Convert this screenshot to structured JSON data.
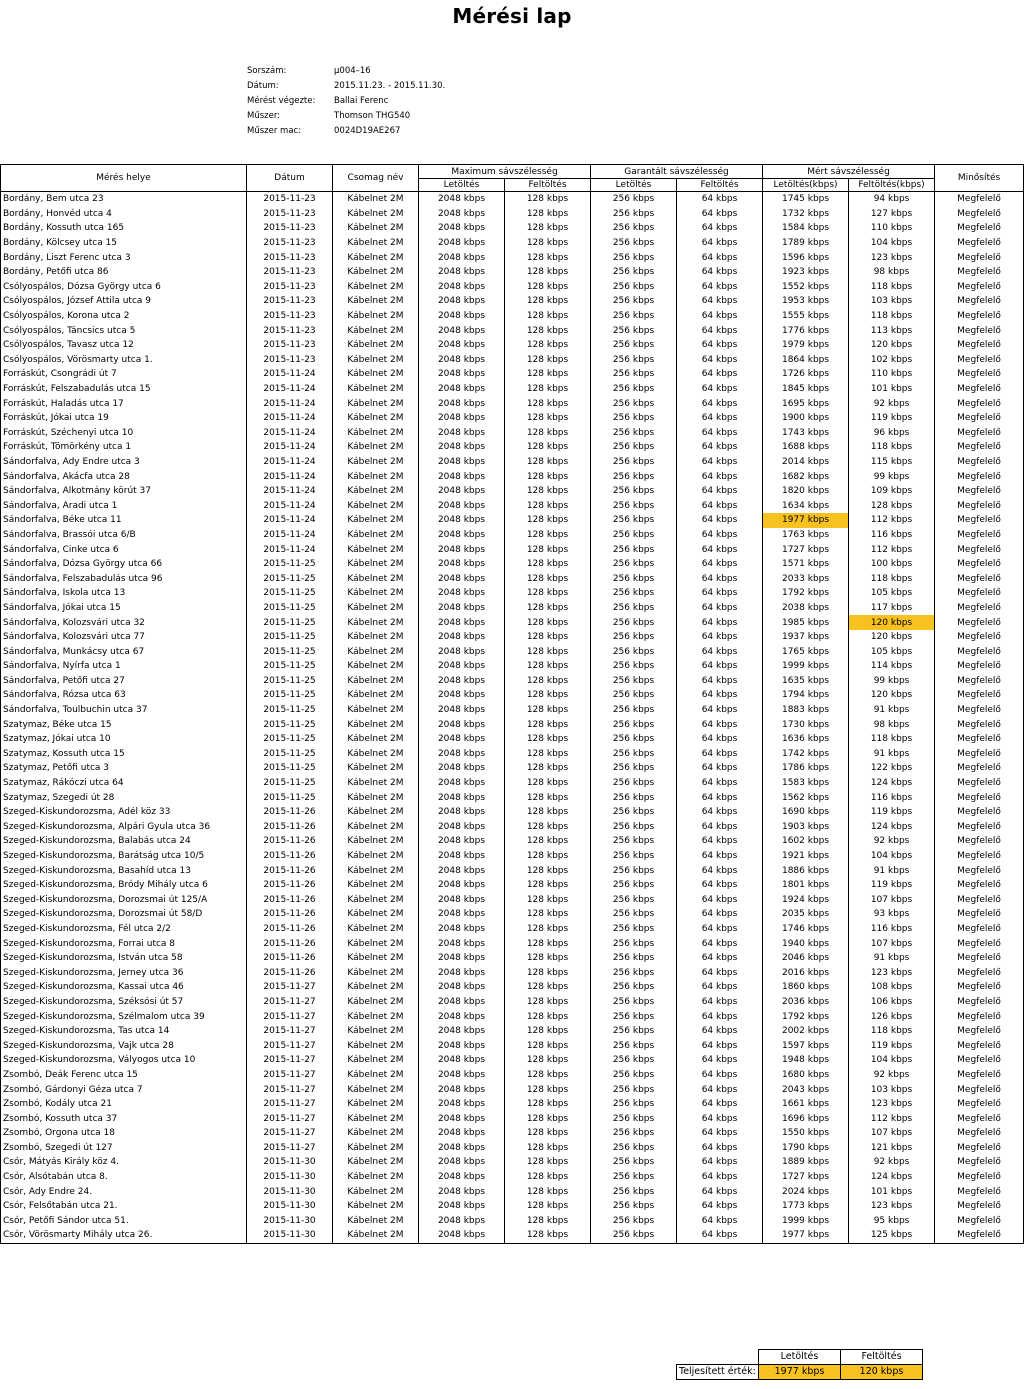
{
  "title": "Mérési lap",
  "meta": [
    {
      "label": "Sorszám:",
      "value": "µ004–16"
    },
    {
      "label": "Dátum:",
      "value": "2015.11.23. - 2015.11.30."
    },
    {
      "label": "Mérést végezte:",
      "value": "Ballai Ferenc"
    },
    {
      "label": "Műszer:",
      "value": "Thomson THG540"
    },
    {
      "label": "Műszer mac:",
      "value": "0024D19AE267"
    }
  ],
  "headers": {
    "place": "Mérés helye",
    "date": "Dátum",
    "package": "Csomag név",
    "max": "Maximum sávszélesség",
    "guaranteed": "Garantált sávszélesség",
    "measured": "Mért sávszélesség",
    "quality": "Minősítés",
    "download": "Letöltés",
    "upload": "Feltöltés",
    "download_kbps": "Letöltés(kbps)",
    "upload_kbps": "Feltöltés(kbps)"
  },
  "highlight_color": "#f7c120",
  "rows": [
    [
      "Bordány, Bem utca 23",
      "2015-11-23",
      "Kábelnet 2M",
      "2048 kbps",
      "128 kbps",
      "256 kbps",
      "64 kbps",
      "1745 kbps",
      "94 kbps",
      "Megfelelő"
    ],
    [
      "Bordány, Honvéd utca 4",
      "2015-11-23",
      "Kábelnet 2M",
      "2048 kbps",
      "128 kbps",
      "256 kbps",
      "64 kbps",
      "1732 kbps",
      "127 kbps",
      "Megfelelő"
    ],
    [
      "Bordány, Kossuth utca 165",
      "2015-11-23",
      "Kábelnet 2M",
      "2048 kbps",
      "128 kbps",
      "256 kbps",
      "64 kbps",
      "1584 kbps",
      "110 kbps",
      "Megfelelő"
    ],
    [
      "Bordány, Kölcsey utca 15",
      "2015-11-23",
      "Kábelnet 2M",
      "2048 kbps",
      "128 kbps",
      "256 kbps",
      "64 kbps",
      "1789 kbps",
      "104 kbps",
      "Megfelelő"
    ],
    [
      "Bordány, Liszt Ferenc utca 3",
      "2015-11-23",
      "Kábelnet 2M",
      "2048 kbps",
      "128 kbps",
      "256 kbps",
      "64 kbps",
      "1596 kbps",
      "123 kbps",
      "Megfelelő"
    ],
    [
      "Bordány, Petőfi utca 86",
      "2015-11-23",
      "Kábelnet 2M",
      "2048 kbps",
      "128 kbps",
      "256 kbps",
      "64 kbps",
      "1923 kbps",
      "98 kbps",
      "Megfelelő"
    ],
    [
      "Csólyospálos, Dózsa György utca 6",
      "2015-11-23",
      "Kábelnet 2M",
      "2048 kbps",
      "128 kbps",
      "256 kbps",
      "64 kbps",
      "1552 kbps",
      "118 kbps",
      "Megfelelő"
    ],
    [
      "Csólyospálos, József Attila utca 9",
      "2015-11-23",
      "Kábelnet 2M",
      "2048 kbps",
      "128 kbps",
      "256 kbps",
      "64 kbps",
      "1953 kbps",
      "103 kbps",
      "Megfelelő"
    ],
    [
      "Csólyospálos, Korona utca 2",
      "2015-11-23",
      "Kábelnet 2M",
      "2048 kbps",
      "128 kbps",
      "256 kbps",
      "64 kbps",
      "1555 kbps",
      "118 kbps",
      "Megfelelő"
    ],
    [
      "Csólyospálos, Táncsics utca 5",
      "2015-11-23",
      "Kábelnet 2M",
      "2048 kbps",
      "128 kbps",
      "256 kbps",
      "64 kbps",
      "1776 kbps",
      "113 kbps",
      "Megfelelő"
    ],
    [
      "Csólyospálos, Tavasz utca 12",
      "2015-11-23",
      "Kábelnet 2M",
      "2048 kbps",
      "128 kbps",
      "256 kbps",
      "64 kbps",
      "1979 kbps",
      "120 kbps",
      "Megfelelő"
    ],
    [
      "Csólyospálos, Vörösmarty utca 1.",
      "2015-11-23",
      "Kábelnet 2M",
      "2048 kbps",
      "128 kbps",
      "256 kbps",
      "64 kbps",
      "1864 kbps",
      "102 kbps",
      "Megfelelő"
    ],
    [
      "Forráskút, Csongrádi út 7",
      "2015-11-24",
      "Kábelnet 2M",
      "2048 kbps",
      "128 kbps",
      "256 kbps",
      "64 kbps",
      "1726 kbps",
      "110 kbps",
      "Megfelelő"
    ],
    [
      "Forráskút, Felszabadulás utca 15",
      "2015-11-24",
      "Kábelnet 2M",
      "2048 kbps",
      "128 kbps",
      "256 kbps",
      "64 kbps",
      "1845 kbps",
      "101 kbps",
      "Megfelelő"
    ],
    [
      "Forráskút, Haladás utca 17",
      "2015-11-24",
      "Kábelnet 2M",
      "2048 kbps",
      "128 kbps",
      "256 kbps",
      "64 kbps",
      "1695 kbps",
      "92 kbps",
      "Megfelelő"
    ],
    [
      "Forráskút, Jókai utca 19",
      "2015-11-24",
      "Kábelnet 2M",
      "2048 kbps",
      "128 kbps",
      "256 kbps",
      "64 kbps",
      "1900 kbps",
      "119 kbps",
      "Megfelelő"
    ],
    [
      "Forráskút, Széchenyi utca 10",
      "2015-11-24",
      "Kábelnet 2M",
      "2048 kbps",
      "128 kbps",
      "256 kbps",
      "64 kbps",
      "1743 kbps",
      "96 kbps",
      "Megfelelő"
    ],
    [
      "Forráskút, Tömörkény utca 1",
      "2015-11-24",
      "Kábelnet 2M",
      "2048 kbps",
      "128 kbps",
      "256 kbps",
      "64 kbps",
      "1688 kbps",
      "118 kbps",
      "Megfelelő"
    ],
    [
      "Sándorfalva, Ady Endre utca 3",
      "2015-11-24",
      "Kábelnet 2M",
      "2048 kbps",
      "128 kbps",
      "256 kbps",
      "64 kbps",
      "2014 kbps",
      "115 kbps",
      "Megfelelő"
    ],
    [
      "Sándorfalva, Akácfa utca 28",
      "2015-11-24",
      "Kábelnet 2M",
      "2048 kbps",
      "128 kbps",
      "256 kbps",
      "64 kbps",
      "1682 kbps",
      "99 kbps",
      "Megfelelő"
    ],
    [
      "Sándorfalva, Alkotmány körút 37",
      "2015-11-24",
      "Kábelnet 2M",
      "2048 kbps",
      "128 kbps",
      "256 kbps",
      "64 kbps",
      "1820 kbps",
      "109 kbps",
      "Megfelelő"
    ],
    [
      "Sándorfalva, Aradi utca 1",
      "2015-11-24",
      "Kábelnet 2M",
      "2048 kbps",
      "128 kbps",
      "256 kbps",
      "64 kbps",
      "1634 kbps",
      "128 kbps",
      "Megfelelő"
    ],
    [
      "Sándorfalva, Béke utca 11",
      "2015-11-24",
      "Kábelnet 2M",
      "2048 kbps",
      "128 kbps",
      "256 kbps",
      "64 kbps",
      "1977 kbps",
      "112 kbps",
      "Megfelelő"
    ],
    [
      "Sándorfalva, Brassói utca 6/B",
      "2015-11-24",
      "Kábelnet 2M",
      "2048 kbps",
      "128 kbps",
      "256 kbps",
      "64 kbps",
      "1763 kbps",
      "116 kbps",
      "Megfelelő"
    ],
    [
      "Sándorfalva, Cinke utca 6",
      "2015-11-24",
      "Kábelnet 2M",
      "2048 kbps",
      "128 kbps",
      "256 kbps",
      "64 kbps",
      "1727 kbps",
      "112 kbps",
      "Megfelelő"
    ],
    [
      "Sándorfalva, Dózsa György utca 66",
      "2015-11-25",
      "Kábelnet 2M",
      "2048 kbps",
      "128 kbps",
      "256 kbps",
      "64 kbps",
      "1571 kbps",
      "100 kbps",
      "Megfelelő"
    ],
    [
      "Sándorfalva, Felszabadulás utca 96",
      "2015-11-25",
      "Kábelnet 2M",
      "2048 kbps",
      "128 kbps",
      "256 kbps",
      "64 kbps",
      "2033 kbps",
      "118 kbps",
      "Megfelelő"
    ],
    [
      "Sándorfalva, Iskola utca 13",
      "2015-11-25",
      "Kábelnet 2M",
      "2048 kbps",
      "128 kbps",
      "256 kbps",
      "64 kbps",
      "1792 kbps",
      "105 kbps",
      "Megfelelő"
    ],
    [
      "Sándorfalva, Jókai utca 15",
      "2015-11-25",
      "Kábelnet 2M",
      "2048 kbps",
      "128 kbps",
      "256 kbps",
      "64 kbps",
      "2038 kbps",
      "117 kbps",
      "Megfelelő"
    ],
    [
      "Sándorfalva, Kolozsvári utca 32",
      "2015-11-25",
      "Kábelnet 2M",
      "2048 kbps",
      "128 kbps",
      "256 kbps",
      "64 kbps",
      "1985 kbps",
      "120 kbps",
      "Megfelelő"
    ],
    [
      "Sándorfalva, Kolozsvári utca 77",
      "2015-11-25",
      "Kábelnet 2M",
      "2048 kbps",
      "128 kbps",
      "256 kbps",
      "64 kbps",
      "1937 kbps",
      "120 kbps",
      "Megfelelő"
    ],
    [
      "Sándorfalva, Munkácsy utca 67",
      "2015-11-25",
      "Kábelnet 2M",
      "2048 kbps",
      "128 kbps",
      "256 kbps",
      "64 kbps",
      "1765 kbps",
      "105 kbps",
      "Megfelelő"
    ],
    [
      "Sándorfalva, Nyírfa utca 1",
      "2015-11-25",
      "Kábelnet 2M",
      "2048 kbps",
      "128 kbps",
      "256 kbps",
      "64 kbps",
      "1999 kbps",
      "114 kbps",
      "Megfelelő"
    ],
    [
      "Sándorfalva, Petőfi utca 27",
      "2015-11-25",
      "Kábelnet 2M",
      "2048 kbps",
      "128 kbps",
      "256 kbps",
      "64 kbps",
      "1635 kbps",
      "99 kbps",
      "Megfelelő"
    ],
    [
      "Sándorfalva, Rózsa utca 63",
      "2015-11-25",
      "Kábelnet 2M",
      "2048 kbps",
      "128 kbps",
      "256 kbps",
      "64 kbps",
      "1794 kbps",
      "120 kbps",
      "Megfelelő"
    ],
    [
      "Sándorfalva, Toulbuchin utca 37",
      "2015-11-25",
      "Kábelnet 2M",
      "2048 kbps",
      "128 kbps",
      "256 kbps",
      "64 kbps",
      "1883 kbps",
      "91 kbps",
      "Megfelelő"
    ],
    [
      "Szatymaz, Béke utca 15",
      "2015-11-25",
      "Kábelnet 2M",
      "2048 kbps",
      "128 kbps",
      "256 kbps",
      "64 kbps",
      "1730 kbps",
      "98 kbps",
      "Megfelelő"
    ],
    [
      "Szatymaz, Jókai utca 10",
      "2015-11-25",
      "Kábelnet 2M",
      "2048 kbps",
      "128 kbps",
      "256 kbps",
      "64 kbps",
      "1636 kbps",
      "118 kbps",
      "Megfelelő"
    ],
    [
      "Szatymaz, Kossuth utca 15",
      "2015-11-25",
      "Kábelnet 2M",
      "2048 kbps",
      "128 kbps",
      "256 kbps",
      "64 kbps",
      "1742 kbps",
      "91 kbps",
      "Megfelelő"
    ],
    [
      "Szatymaz, Petőfi utca 3",
      "2015-11-25",
      "Kábelnet 2M",
      "2048 kbps",
      "128 kbps",
      "256 kbps",
      "64 kbps",
      "1786 kbps",
      "122 kbps",
      "Megfelelő"
    ],
    [
      "Szatymaz, Rákóczi utca 64",
      "2015-11-25",
      "Kábelnet 2M",
      "2048 kbps",
      "128 kbps",
      "256 kbps",
      "64 kbps",
      "1583 kbps",
      "124 kbps",
      "Megfelelő"
    ],
    [
      "Szatymaz, Szegedi út 28",
      "2015-11-25",
      "Kábelnet 2M",
      "2048 kbps",
      "128 kbps",
      "256 kbps",
      "64 kbps",
      "1562 kbps",
      "116 kbps",
      "Megfelelő"
    ],
    [
      "Szeged-Kiskundorozsma, Adél köz 33",
      "2015-11-26",
      "Kábelnet 2M",
      "2048 kbps",
      "128 kbps",
      "256 kbps",
      "64 kbps",
      "1690 kbps",
      "119 kbps",
      "Megfelelő"
    ],
    [
      "Szeged-Kiskundorozsma, Alpári Gyula utca 36",
      "2015-11-26",
      "Kábelnet 2M",
      "2048 kbps",
      "128 kbps",
      "256 kbps",
      "64 kbps",
      "1903 kbps",
      "124 kbps",
      "Megfelelő"
    ],
    [
      "Szeged-Kiskundorozsma, Balabás utca 24",
      "2015-11-26",
      "Kábelnet 2M",
      "2048 kbps",
      "128 kbps",
      "256 kbps",
      "64 kbps",
      "1602 kbps",
      "92 kbps",
      "Megfelelő"
    ],
    [
      "Szeged-Kiskundorozsma, Barátság utca 10/5",
      "2015-11-26",
      "Kábelnet 2M",
      "2048 kbps",
      "128 kbps",
      "256 kbps",
      "64 kbps",
      "1921 kbps",
      "104 kbps",
      "Megfelelő"
    ],
    [
      "Szeged-Kiskundorozsma, Basahíd utca 13",
      "2015-11-26",
      "Kábelnet 2M",
      "2048 kbps",
      "128 kbps",
      "256 kbps",
      "64 kbps",
      "1886 kbps",
      "91 kbps",
      "Megfelelő"
    ],
    [
      "Szeged-Kiskundorozsma, Bródy Mihály utca 6",
      "2015-11-26",
      "Kábelnet 2M",
      "2048 kbps",
      "128 kbps",
      "256 kbps",
      "64 kbps",
      "1801 kbps",
      "119 kbps",
      "Megfelelő"
    ],
    [
      "Szeged-Kiskundorozsma, Dorozsmai út 125/A",
      "2015-11-26",
      "Kábelnet 2M",
      "2048 kbps",
      "128 kbps",
      "256 kbps",
      "64 kbps",
      "1924 kbps",
      "107 kbps",
      "Megfelelő"
    ],
    [
      "Szeged-Kiskundorozsma, Dorozsmai út 58/D",
      "2015-11-26",
      "Kábelnet 2M",
      "2048 kbps",
      "128 kbps",
      "256 kbps",
      "64 kbps",
      "2035 kbps",
      "93 kbps",
      "Megfelelő"
    ],
    [
      "Szeged-Kiskundorozsma, Fél utca 2/2",
      "2015-11-26",
      "Kábelnet 2M",
      "2048 kbps",
      "128 kbps",
      "256 kbps",
      "64 kbps",
      "1746 kbps",
      "116 kbps",
      "Megfelelő"
    ],
    [
      "Szeged-Kiskundorozsma, Forrai utca 8",
      "2015-11-26",
      "Kábelnet 2M",
      "2048 kbps",
      "128 kbps",
      "256 kbps",
      "64 kbps",
      "1940 kbps",
      "107 kbps",
      "Megfelelő"
    ],
    [
      "Szeged-Kiskundorozsma, István utca 58",
      "2015-11-26",
      "Kábelnet 2M",
      "2048 kbps",
      "128 kbps",
      "256 kbps",
      "64 kbps",
      "2046 kbps",
      "91 kbps",
      "Megfelelő"
    ],
    [
      "Szeged-Kiskundorozsma, Jerney utca 36",
      "2015-11-26",
      "Kábelnet 2M",
      "2048 kbps",
      "128 kbps",
      "256 kbps",
      "64 kbps",
      "2016 kbps",
      "123 kbps",
      "Megfelelő"
    ],
    [
      "Szeged-Kiskundorozsma, Kassai utca 46",
      "2015-11-27",
      "Kábelnet 2M",
      "2048 kbps",
      "128 kbps",
      "256 kbps",
      "64 kbps",
      "1860 kbps",
      "108 kbps",
      "Megfelelő"
    ],
    [
      "Szeged-Kiskundorozsma, Széksósi út 57",
      "2015-11-27",
      "Kábelnet 2M",
      "2048 kbps",
      "128 kbps",
      "256 kbps",
      "64 kbps",
      "2036 kbps",
      "106 kbps",
      "Megfelelő"
    ],
    [
      "Szeged-Kiskundorozsma, Szélmalom utca 39",
      "2015-11-27",
      "Kábelnet 2M",
      "2048 kbps",
      "128 kbps",
      "256 kbps",
      "64 kbps",
      "1792 kbps",
      "126 kbps",
      "Megfelelő"
    ],
    [
      "Szeged-Kiskundorozsma, Tas utca 14",
      "2015-11-27",
      "Kábelnet 2M",
      "2048 kbps",
      "128 kbps",
      "256 kbps",
      "64 kbps",
      "2002 kbps",
      "118 kbps",
      "Megfelelő"
    ],
    [
      "Szeged-Kiskundorozsma, Vajk utca 28",
      "2015-11-27",
      "Kábelnet 2M",
      "2048 kbps",
      "128 kbps",
      "256 kbps",
      "64 kbps",
      "1597 kbps",
      "119 kbps",
      "Megfelelő"
    ],
    [
      "Szeged-Kiskundorozsma, Vályogos utca 10",
      "2015-11-27",
      "Kábelnet 2M",
      "2048 kbps",
      "128 kbps",
      "256 kbps",
      "64 kbps",
      "1948 kbps",
      "104 kbps",
      "Megfelelő"
    ],
    [
      "Zsombó, Deák Ferenc utca 15",
      "2015-11-27",
      "Kábelnet 2M",
      "2048 kbps",
      "128 kbps",
      "256 kbps",
      "64 kbps",
      "1680 kbps",
      "92 kbps",
      "Megfelelő"
    ],
    [
      "Zsombó, Gárdonyi Géza utca 7",
      "2015-11-27",
      "Kábelnet 2M",
      "2048 kbps",
      "128 kbps",
      "256 kbps",
      "64 kbps",
      "2043 kbps",
      "103 kbps",
      "Megfelelő"
    ],
    [
      "Zsombó, Kodály utca 21",
      "2015-11-27",
      "Kábelnet 2M",
      "2048 kbps",
      "128 kbps",
      "256 kbps",
      "64 kbps",
      "1661 kbps",
      "123 kbps",
      "Megfelelő"
    ],
    [
      "Zsombó, Kossuth utca 37",
      "2015-11-27",
      "Kábelnet 2M",
      "2048 kbps",
      "128 kbps",
      "256 kbps",
      "64 kbps",
      "1696 kbps",
      "112 kbps",
      "Megfelelő"
    ],
    [
      "Zsombó, Orgona utca 18",
      "2015-11-27",
      "Kábelnet 2M",
      "2048 kbps",
      "128 kbps",
      "256 kbps",
      "64 kbps",
      "1550 kbps",
      "107 kbps",
      "Megfelelő"
    ],
    [
      "Zsombó, Szegedi út 127",
      "2015-11-27",
      "Kábelnet 2M",
      "2048 kbps",
      "128 kbps",
      "256 kbps",
      "64 kbps",
      "1790 kbps",
      "121 kbps",
      "Megfelelő"
    ],
    [
      "Csór, Mátyás Király köz 4.",
      "2015-11-30",
      "Kábelnet 2M",
      "2048 kbps",
      "128 kbps",
      "256 kbps",
      "64 kbps",
      "1889 kbps",
      "92 kbps",
      "Megfelelő"
    ],
    [
      "Csór, Alsótabán utca 8.",
      "2015-11-30",
      "Kábelnet 2M",
      "2048 kbps",
      "128 kbps",
      "256 kbps",
      "64 kbps",
      "1727 kbps",
      "124 kbps",
      "Megfelelő"
    ],
    [
      "Csór, Ady Endre 24.",
      "2015-11-30",
      "Kábelnet 2M",
      "2048 kbps",
      "128 kbps",
      "256 kbps",
      "64 kbps",
      "2024 kbps",
      "101 kbps",
      "Megfelelő"
    ],
    [
      "Csór, Felsőtabán utca 21.",
      "2015-11-30",
      "Kábelnet 2M",
      "2048 kbps",
      "128 kbps",
      "256 kbps",
      "64 kbps",
      "1773 kbps",
      "123 kbps",
      "Megfelelő"
    ],
    [
      "Csór, Petőfi Sándor utca 51.",
      "2015-11-30",
      "Kábelnet 2M",
      "2048 kbps",
      "128 kbps",
      "256 kbps",
      "64 kbps",
      "1999 kbps",
      "95 kbps",
      "Megfelelő"
    ],
    [
      "Csór, Vörösmarty Mihály utca 26.",
      "2015-11-30",
      "Kábelnet 2M",
      "2048 kbps",
      "128 kbps",
      "256 kbps",
      "64 kbps",
      "1977 kbps",
      "125 kbps",
      "Megfelelő"
    ]
  ],
  "highlights": [
    {
      "row": 22,
      "col": 7
    },
    {
      "row": 29,
      "col": 8
    }
  ],
  "summary": {
    "download_header": "Letöltés",
    "upload_header": "Feltöltés",
    "label": "Teljesített érték:",
    "download": "1977  kbps",
    "upload": "120  kbps"
  }
}
